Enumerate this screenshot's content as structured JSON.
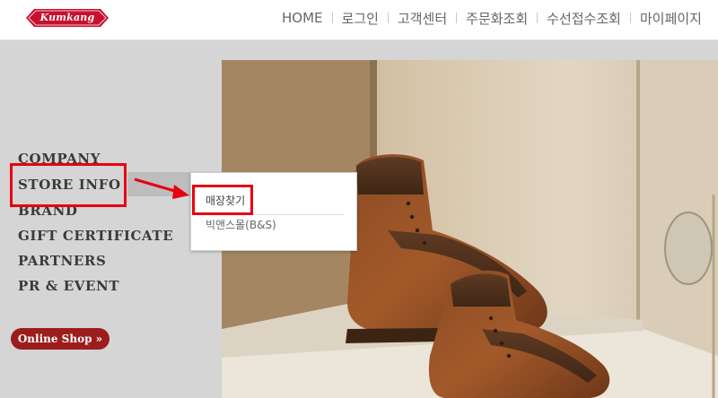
{
  "header": {
    "logo_text": "Kumkang",
    "nav": [
      "HOME",
      "로그인",
      "고객센터",
      "주문화조회",
      "수선접수조회",
      "마이페이지"
    ]
  },
  "sidenav": {
    "items": [
      "COMPANY",
      "STORE INFO",
      "BRAND",
      "GIFT CERTIFICATE",
      "PARTNERS",
      "PR & EVENT"
    ],
    "online_shop": "Online Shop »"
  },
  "dropdown": {
    "items": [
      "매장찾기",
      "빅앤스몰(B&S)"
    ]
  },
  "colors": {
    "brand_red": "#c8102e",
    "annotation_red": "#e60012",
    "online_shop_bg": "#9c1d1d"
  }
}
